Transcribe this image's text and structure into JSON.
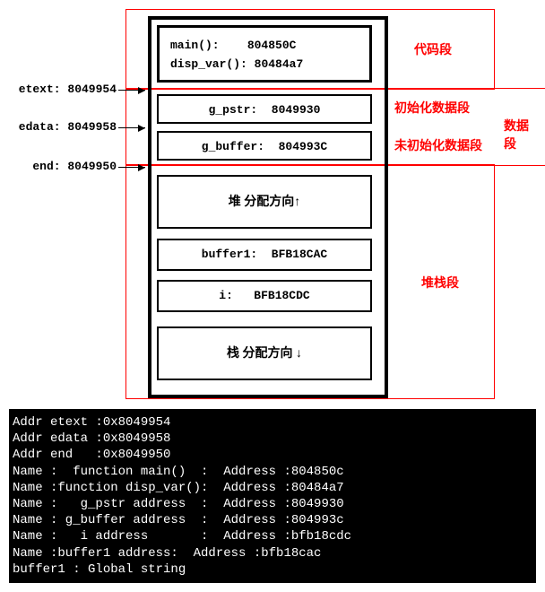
{
  "diagram": {
    "code_section": {
      "line1_left": "main():",
      "line1_right": "804850C",
      "line2_left": "disp_var():",
      "line2_right": "80484a7"
    },
    "gpstr": {
      "label": "g_pstr:",
      "value": "8049930"
    },
    "gbuffer": {
      "label": "g_buffer:",
      "value": "804993C"
    },
    "heap": "堆  分配方向↑",
    "buffer1": {
      "label": "buffer1:",
      "value": "BFB18CAC"
    },
    "ivar": {
      "label": "i:",
      "value": "BFB18CDC"
    },
    "stack": "栈   分配方向 ↓",
    "arrows": {
      "etext": "etext: 8049954",
      "edata": "edata: 8049958",
      "end": "end: 8049950"
    },
    "red_labels": {
      "code": "代码段",
      "init": "初始化数据段",
      "uninit": "未初始化数据段",
      "data_group": "数据段",
      "stack_group": "堆栈段"
    }
  },
  "terminal": {
    "l1": "Addr etext :0x8049954",
    "l2": "Addr edata :0x8049958",
    "l3": "Addr end   :0x8049950",
    "l4": "Name :  function main()  :  Address :804850c",
    "l5": "Name :function disp_var():  Address :80484a7",
    "l6": "Name :   g_pstr address  :  Address :8049930",
    "l7": "Name : g_buffer address  :  Address :804993c",
    "l8": "Name :   i address       :  Address :bfb18cdc",
    "l9": "Name :buffer1 address:  Address :bfb18cac",
    "l10": "buffer1 : Global string"
  }
}
